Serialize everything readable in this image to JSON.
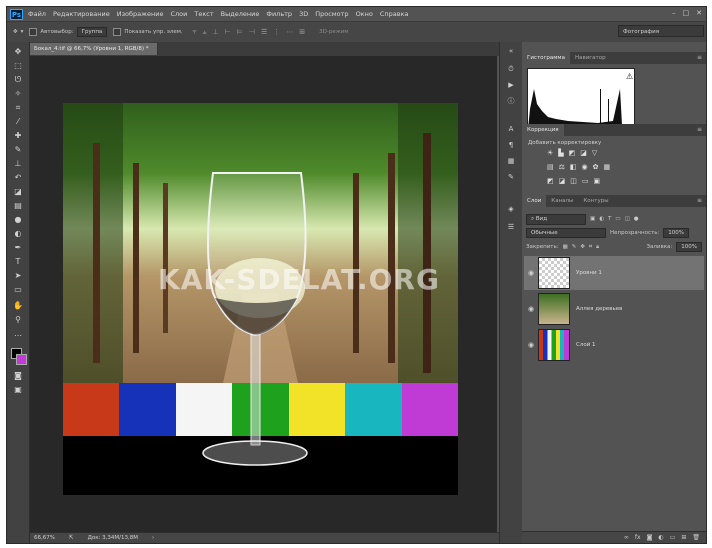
{
  "menu": {
    "logo": "Ps",
    "items": [
      "Файл",
      "Редактирование",
      "Изображение",
      "Слои",
      "Текст",
      "Выделение",
      "Фильтр",
      "3D",
      "Просмотр",
      "Окно",
      "Справка"
    ]
  },
  "options": {
    "autoselect_label": "Автовыбор:",
    "autoselect_value": "Группа",
    "show_controls_label": "Показать упр. элем.",
    "mode3d_label": "3D-режим",
    "workspace_value": "Фотография"
  },
  "document": {
    "tab_title": "Бокал_4.tif @ 66,7% (Уровни 1, RGB/8) *",
    "watermark": "KAK-SDELAT.ORG",
    "color_bars": [
      "#c8391a",
      "#1632b8",
      "#f5f5f5",
      "#1ea21e",
      "#f2e228",
      "#18b6bf",
      "#c03ad6"
    ]
  },
  "status": {
    "zoom": "66,67%",
    "doc_size": "Док: 3,34M/13,8M"
  },
  "panels": {
    "histogram_tabs": [
      "Гистограмма",
      "Навигатор"
    ],
    "correction_tab": "Коррекция",
    "correction_hint": "Добавить корректировку",
    "layers_tabs": [
      "Слои",
      "Каналы",
      "Контуры"
    ],
    "kind_filter": "Вид",
    "blend_mode": "Обычные",
    "opacity_label": "Непрозрачность:",
    "opacity_value": "100%",
    "lock_label": "Закрепить:",
    "fill_label": "Заливка:",
    "fill_value": "100%",
    "layers": [
      {
        "name": "Уровни 1",
        "active": true
      },
      {
        "name": "Аллея деревьев",
        "active": false
      },
      {
        "name": "Слой 1",
        "active": false
      }
    ]
  }
}
